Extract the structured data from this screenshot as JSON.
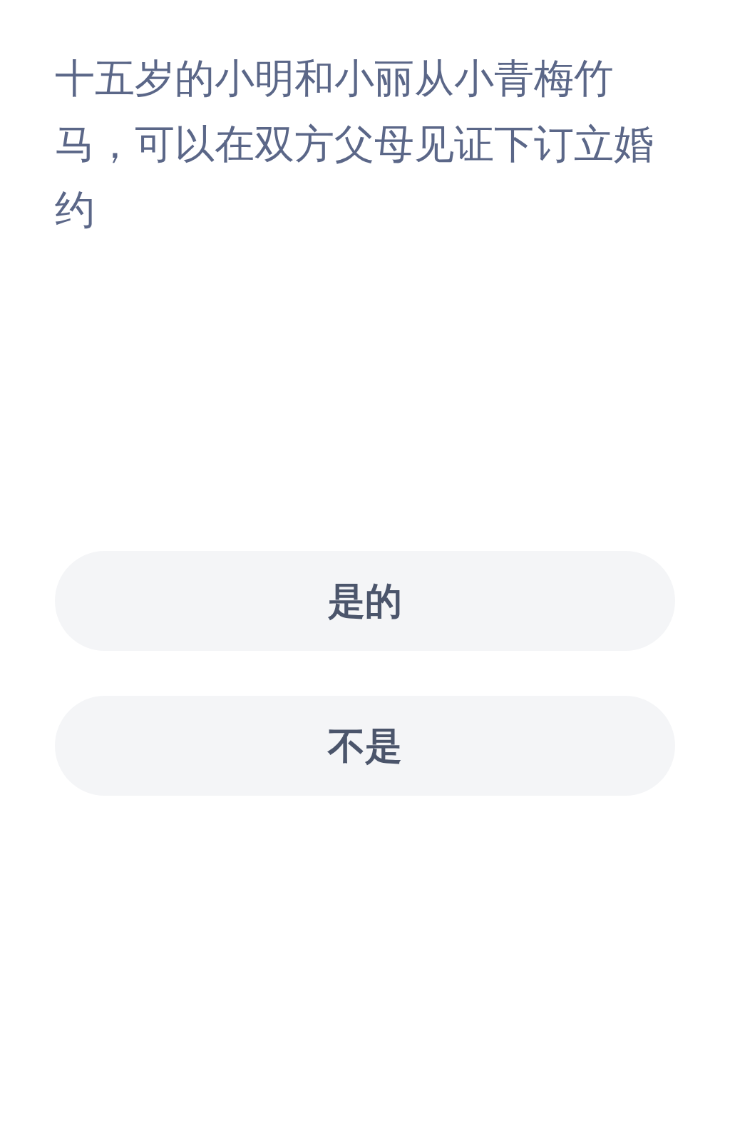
{
  "question": "十五岁的小明和小丽从小青梅竹马，可以在双方父母见证下订立婚约",
  "options": [
    {
      "label": "是的"
    },
    {
      "label": "不是"
    }
  ]
}
